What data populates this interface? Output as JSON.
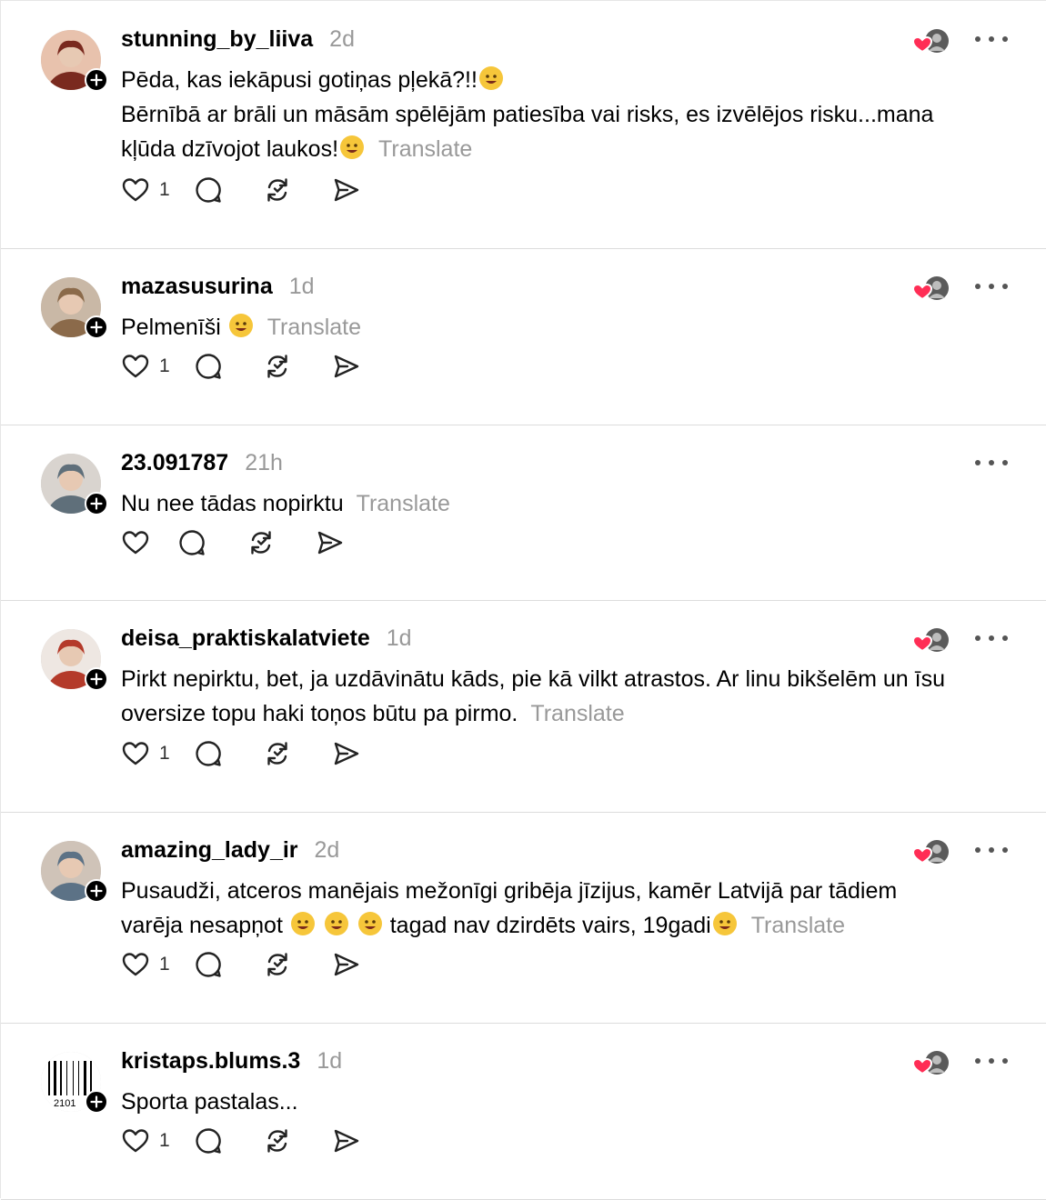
{
  "translate_label": "Translate",
  "posts": [
    {
      "username": "stunning_by_liiva",
      "time": "2d",
      "line1": "Pēda, kas iekāpusi gotiņas pļekā?!!",
      "line2": "Bērnībā ar brāli un māsām spēlējām patiesība vai risks, es izvēlējos risku...mana kļūda dzīvojot laukos!",
      "likes": "1"
    },
    {
      "username": "mazasusurina",
      "time": "1d",
      "line1": "Pelmenīši",
      "likes": "1"
    },
    {
      "username": "23.091787",
      "time": "21h",
      "line1": "Nu nee tādas nopirktu",
      "likes": ""
    },
    {
      "username": "deisa_praktiskalatviete",
      "time": "1d",
      "line1": "Pirkt nepirktu, bet, ja uzdāvinātu kāds, pie kā vilkt atrastos. Ar linu bikšelēm un īsu",
      "line2": "oversize topu haki toņos būtu pa pirmo.",
      "likes": "1"
    },
    {
      "username": "amazing_lady_ir",
      "time": "2d",
      "line1": "Pusaudži, atceros manējais mežonīgi gribēja jīzijus, kamēr Latvijā par tādiem",
      "line2a": "varēja nesapņot",
      "line2b": "tagad nav dzirdēts vairs, 19gadi",
      "likes": "1"
    },
    {
      "username": "kristaps.blums.3",
      "time": "1d",
      "line1": "Sporta pastalas...",
      "avatar_text": "2101",
      "likes": "1"
    }
  ],
  "icons": {
    "like": "heart-icon",
    "reply": "comment-bubble-icon",
    "repost": "repost-arrows-icon",
    "share": "send-icon",
    "more": "more-dots-icon",
    "follow": "plus-icon"
  },
  "colors": {
    "heart_red": "#ff2d55",
    "muted": "#999999",
    "follow_badge": "#000000"
  }
}
